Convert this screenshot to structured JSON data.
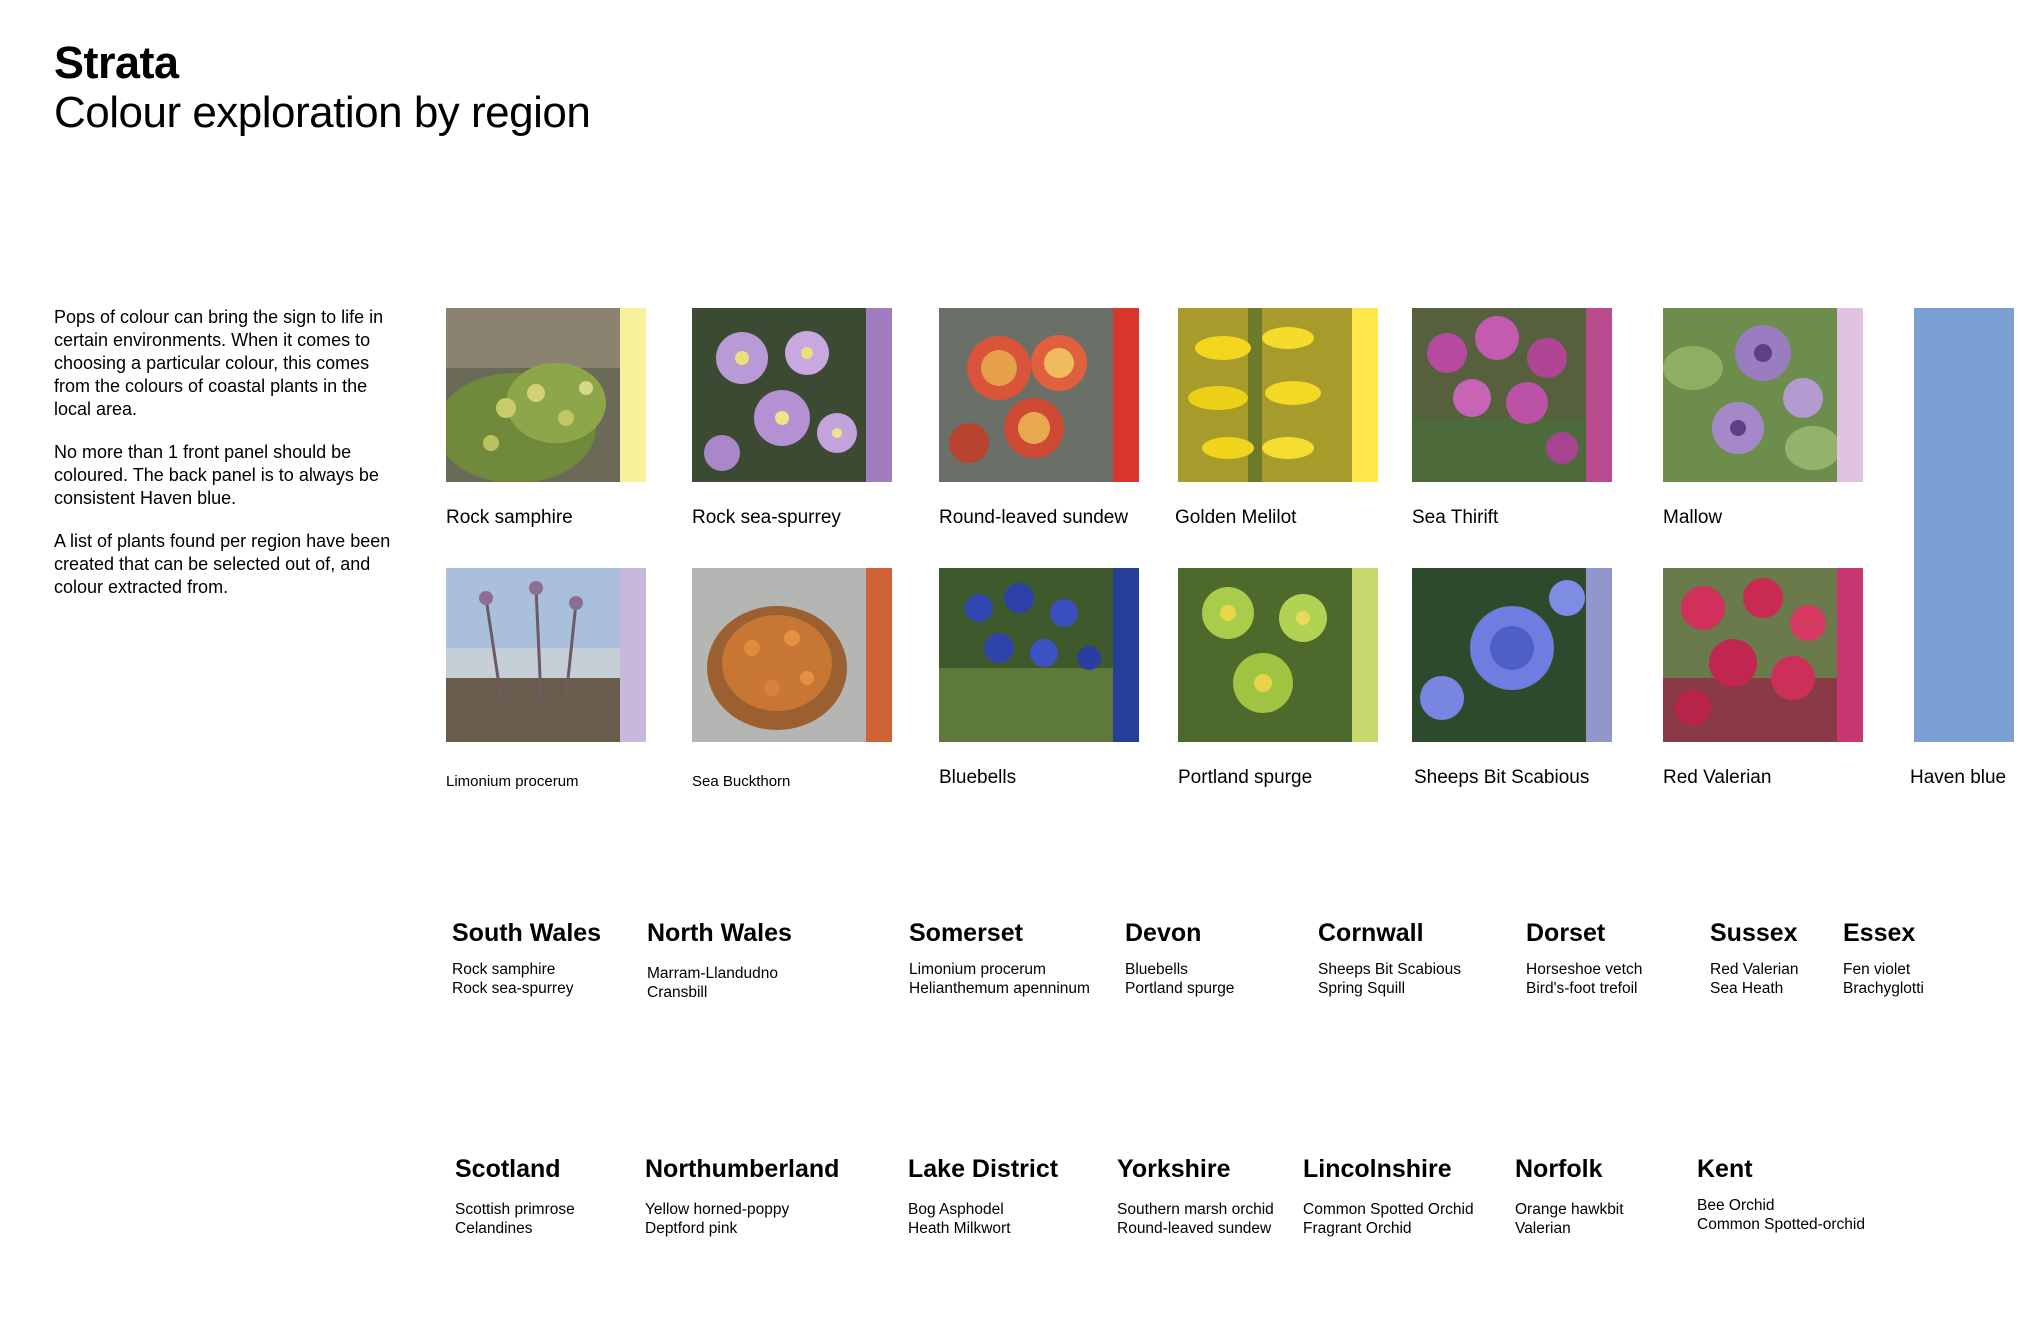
{
  "header": {
    "title": "Strata",
    "subtitle": "Colour exploration by region"
  },
  "intro": {
    "paragraphs": [
      "Pops of colour can bring the sign to life in certain environments. When it comes to choosing a particular colour, this comes from the colours of coastal plants in the local area.",
      "No more than 1 front panel should be coloured. The back panel is to always be consistent Haven blue.",
      "A list of plants found per region have been created that can be selected out of, and colour extracted from."
    ]
  },
  "swatches": [
    {
      "name": "Rock samphire",
      "color": "#f8f09a"
    },
    {
      "name": "Rock sea-spurrey",
      "color": "#a27cc0"
    },
    {
      "name": "Round-leaved sundew",
      "color": "#d9372b"
    },
    {
      "name": "Golden Melilot",
      "color": "#ffe84a"
    },
    {
      "name": "Sea Thirift",
      "color": "#b94b8e"
    },
    {
      "name": "Mallow",
      "color": "#dfc3e0"
    },
    {
      "name": "Limonium procerum",
      "color": "#c9b8de"
    },
    {
      "name": "Sea Buckthorn",
      "color": "#d06335"
    },
    {
      "name": "Bluebells",
      "color": "#283f9a"
    },
    {
      "name": "Portland spurge",
      "color": "#c6d86b"
    },
    {
      "name": "Sheeps Bit Scabious",
      "color": "#9196cc"
    },
    {
      "name": "Red Valerian",
      "color": "#c83870"
    }
  ],
  "haven": {
    "name": "Haven blue",
    "color": "#7aa0d3"
  },
  "regions": [
    {
      "name": "South Wales",
      "plants": [
        "Rock samphire",
        "Rock sea-spurrey"
      ]
    },
    {
      "name": "North Wales",
      "plants": [
        "Marram-Llandudno",
        "Cransbill"
      ]
    },
    {
      "name": "Somerset",
      "plants": [
        "Limonium procerum",
        "Helianthemum apenninum"
      ]
    },
    {
      "name": "Devon",
      "plants": [
        "Bluebells",
        "Portland spurge"
      ]
    },
    {
      "name": "Cornwall",
      "plants": [
        "Sheeps Bit Scabious",
        "Spring Squill"
      ]
    },
    {
      "name": "Dorset",
      "plants": [
        "Horseshoe vetch",
        "Bird's-foot trefoil"
      ]
    },
    {
      "name": "Sussex",
      "plants": [
        "Red Valerian",
        "Sea Heath"
      ]
    },
    {
      "name": "Essex",
      "plants": [
        "Fen violet",
        "Brachyglotti"
      ]
    },
    {
      "name": "Scotland",
      "plants": [
        "Scottish primrose",
        "Celandines"
      ]
    },
    {
      "name": "Northumberland",
      "plants": [
        "Yellow horned-poppy",
        "Deptford pink"
      ]
    },
    {
      "name": "Lake District",
      "plants": [
        "Bog Asphodel",
        "Heath Milkwort"
      ]
    },
    {
      "name": "Yorkshire",
      "plants": [
        "Southern marsh orchid",
        "Round-leaved sundew"
      ]
    },
    {
      "name": "Lincolnshire",
      "plants": [
        "Common Spotted Orchid",
        "Fragrant Orchid"
      ]
    },
    {
      "name": "Norfolk",
      "plants": [
        "Orange hawkbit",
        "Valerian"
      ]
    },
    {
      "name": "Kent",
      "plants": [
        "Bee Orchid",
        "Common Spotted-orchid"
      ]
    }
  ]
}
